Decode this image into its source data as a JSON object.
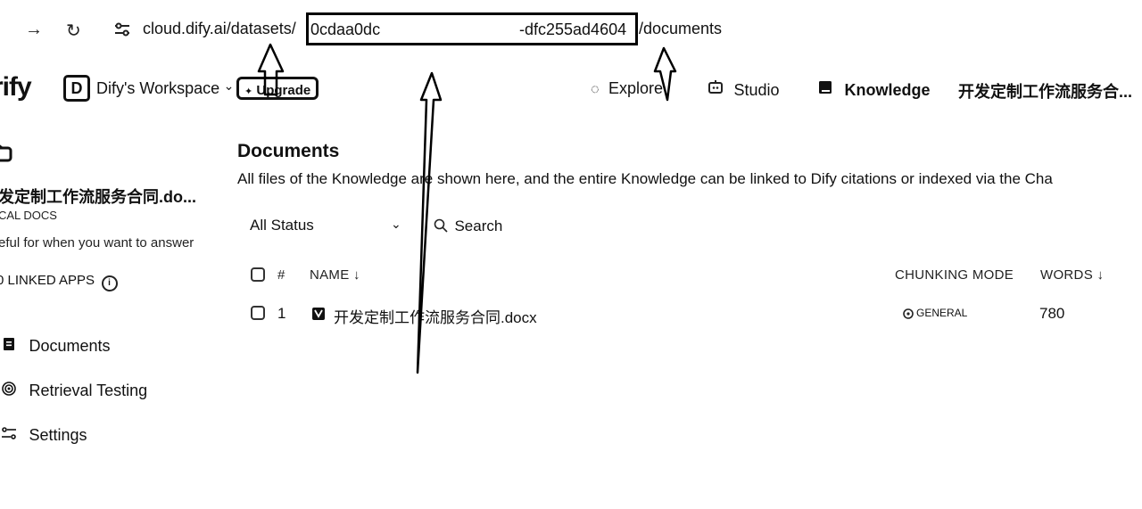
{
  "browser": {
    "forward_icon": "→",
    "reload_icon": "↻",
    "site_settings_icon": "⚙",
    "url_prefix": "cloud.dify.ai/datasets/",
    "url_id_start": "0cdaa0dc",
    "url_id_end": "-dfc255ad4604",
    "url_suffix": "/documents"
  },
  "header": {
    "logo": "rify",
    "workspace_badge": "D",
    "workspace_name": "Dify's Workspace",
    "workspace_chevron": "⌄",
    "upgrade_label": "Upgrade",
    "nav": {
      "explore": "Explore",
      "studio": "Studio",
      "knowledge": "Knowledge",
      "current_dataset": "开发定制工作流服务合..."
    }
  },
  "sidebar": {
    "dataset_title": "发定制工作流服务合同.do...",
    "dataset_type": "CAL DOCS",
    "dataset_description": "eful for when you want to answer",
    "linked_apps": "0 LINKED APPS",
    "items": [
      {
        "label": "Documents",
        "icon": "document-icon"
      },
      {
        "label": "Retrieval Testing",
        "icon": "target-icon"
      },
      {
        "label": "Settings",
        "icon": "settings-sliders-icon"
      }
    ]
  },
  "main": {
    "title": "Documents",
    "description": "All files of the Knowledge are shown here, and the entire Knowledge can be linked to Dify citations or indexed via the Cha",
    "filter": {
      "status_label": "All Status",
      "search_placeholder": "Search"
    },
    "table": {
      "columns": {
        "index": "#",
        "name": "NAME ↓",
        "chunking_mode": "CHUNKING MODE",
        "words": "WORDS ↓"
      },
      "rows": [
        {
          "index": "1",
          "name": "开发定制工作流服务合同.docx",
          "chunking_mode": "GENERAL",
          "words": "780"
        }
      ]
    }
  }
}
